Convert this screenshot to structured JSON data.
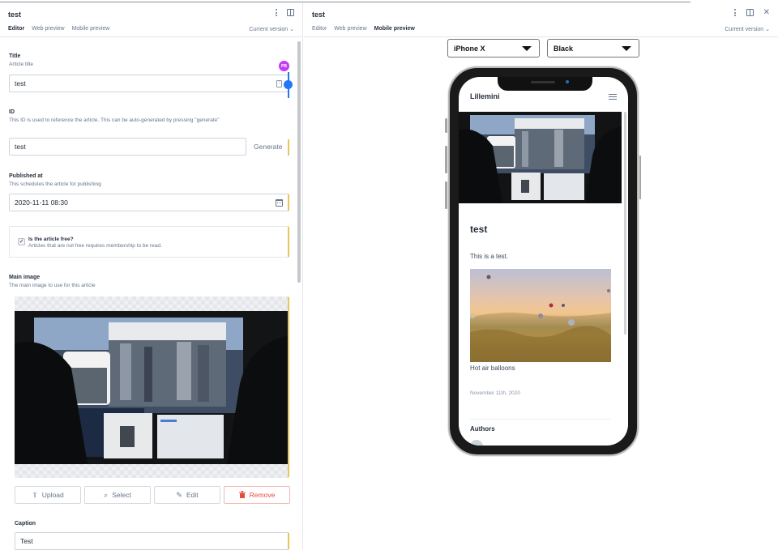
{
  "left_pane": {
    "title": "test",
    "tabs": [
      {
        "label": "Editor",
        "active": true
      },
      {
        "label": "Web preview",
        "active": false
      },
      {
        "label": "Mobile preview",
        "active": false
      }
    ],
    "version_label": "Current version",
    "icons": [
      "kebab-menu-icon",
      "split-pane-icon"
    ]
  },
  "editor": {
    "presence_avatar": "PB",
    "title_field": {
      "label": "Title",
      "description": "Article title",
      "value": "test"
    },
    "id_field": {
      "label": "ID",
      "description": "This ID is used to reference the article. This can be auto-generated by pressing \"generate\"",
      "value": "test",
      "generate_label": "Generate"
    },
    "published_field": {
      "label": "Published at",
      "description": "This schedules the article for publishing",
      "value": "2020-11-11 08:30"
    },
    "free_field": {
      "label": "Is the article free?",
      "description": "Articles that are not free requires membership to be read.",
      "checked": true,
      "check_glyph": "✓"
    },
    "main_image": {
      "label": "Main image",
      "description": "The main image to use for this article"
    },
    "image_buttons": [
      {
        "label": "Upload",
        "icon": "⇪",
        "icon_name": "upload-icon"
      },
      {
        "label": "Select",
        "icon": "⌕",
        "icon_name": "search-icon"
      },
      {
        "label": "Edit",
        "icon": "✎",
        "icon_name": "pencil-icon"
      },
      {
        "label": "Remove",
        "icon": "🗑",
        "icon_name": "trash-icon"
      }
    ],
    "caption_field": {
      "label": "Caption",
      "value": "Test"
    }
  },
  "right_pane": {
    "title": "test",
    "tabs": [
      {
        "label": "Editor",
        "active": false
      },
      {
        "label": "Web preview",
        "active": false
      },
      {
        "label": "Mobile preview",
        "active": true
      }
    ],
    "version_label": "Current version",
    "device_select": "iPhone X",
    "color_select": "Black"
  },
  "mobile": {
    "brand": "Lillemini",
    "article_title": "test",
    "body": "This is a test.",
    "image_caption": "Hot air balloons",
    "date": "November 11th, 2020",
    "authors_heading": "Authors"
  },
  "colors": {
    "accent_bar": "#e6c65a",
    "presence_blue": "#2276fc",
    "avatar_purple": "#c53bf0",
    "danger": "#e64a3b"
  }
}
